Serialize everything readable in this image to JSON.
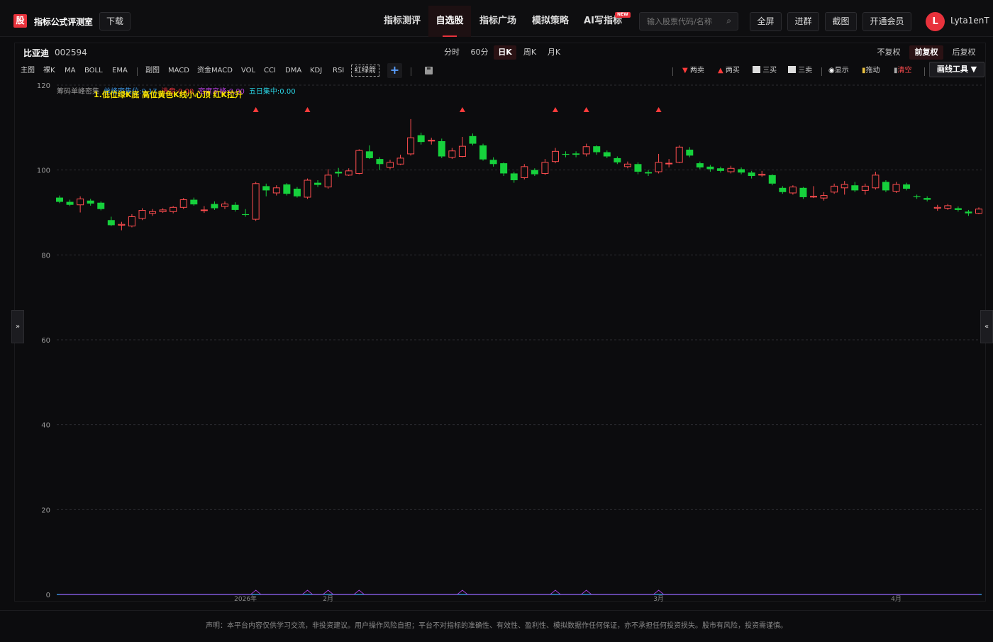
{
  "header": {
    "logo_char": "股",
    "brand": "指标公式评测室",
    "download": "下载",
    "nav": [
      {
        "label": "指标测评",
        "active": false
      },
      {
        "label": "自选股",
        "active": true
      },
      {
        "label": "指标广场",
        "active": false
      },
      {
        "label": "模拟策略",
        "active": false
      },
      {
        "label": "AI写指标",
        "active": false
      }
    ],
    "new_badge": "NEW",
    "search_placeholder": "输入股票代码/名称",
    "search_icon": "search-icon",
    "buttons": [
      "全屏",
      "进群",
      "截图",
      "开通会员"
    ],
    "avatar_letter": "L",
    "username": "Lyta1enT"
  },
  "stock": {
    "name": "比亚迪",
    "code": "002594"
  },
  "periods": [
    {
      "label": "分时",
      "active": false
    },
    {
      "label": "60分",
      "active": false
    },
    {
      "label": "日K",
      "active": true
    },
    {
      "label": "周K",
      "active": false
    },
    {
      "label": "月K",
      "active": false
    }
  ],
  "adjust": [
    {
      "label": "不复权",
      "active": false
    },
    {
      "label": "前复权",
      "active": true
    },
    {
      "label": "后复权",
      "active": false
    }
  ],
  "indicators_main": [
    "主图",
    "裸K",
    "MA",
    "BOLL",
    "EMA"
  ],
  "indicators_sub": [
    "副图",
    "MACD",
    "资金MACD",
    "VOL",
    "CCI",
    "DMA",
    "KDJ",
    "RSI"
  ],
  "highlighted_indicator": "红绿箭",
  "add_label": "+",
  "tools": {
    "sell2": "两卖",
    "buy2": "两买",
    "buy3": "三买",
    "sell3": "三卖",
    "show": "显示",
    "drag": "拖动",
    "clear": "清空",
    "draw_tool": "画线工具 ▼"
  },
  "legend": [
    {
      "text": "筹码单峰密集",
      "color": "#9a9a9a"
    },
    {
      "text": "单峰密集位:0.17",
      "color": "#3a8fd8"
    },
    {
      "text": "洗盘:0.00",
      "color": "#e8323c"
    },
    {
      "text": "密度高峰:0.00",
      "color": "#b23cd8"
    },
    {
      "text": "五日集中:0.00",
      "color": "#2ad8e8"
    }
  ],
  "overlay_text": "1.低位绿K底 高位黄色K线小心顶 红K拉升",
  "x_axis_labels": [
    "2026年",
    "2月",
    "3月",
    "4月"
  ],
  "chart_data": {
    "type": "candlestick",
    "ylim": [
      0,
      120
    ],
    "yticks": [
      0,
      20,
      40,
      60,
      80,
      100,
      120
    ],
    "colors": {
      "up": "#ff4d4f",
      "down": "#16d13c",
      "marker": "#ff3b3b",
      "signal": "#a03cd8",
      "baseline": "#3a8fd8"
    },
    "candles": [
      [
        93.5,
        92.5,
        94.0,
        92.2
      ],
      [
        92.5,
        91.8,
        93.0,
        91.5
      ],
      [
        91.8,
        93.2,
        93.8,
        90.0
      ],
      [
        92.8,
        92.1,
        93.2,
        91.6
      ],
      [
        92.3,
        90.8,
        92.6,
        90.5
      ],
      [
        88.2,
        87.0,
        89.0,
        86.8
      ],
      [
        87.0,
        87.2,
        87.8,
        85.8
      ],
      [
        86.8,
        89.0,
        89.6,
        86.5
      ],
      [
        88.6,
        90.5,
        91.0,
        88.2
      ],
      [
        89.8,
        90.2,
        90.8,
        89.2
      ],
      [
        90.2,
        90.6,
        91.0,
        89.9
      ],
      [
        90.2,
        91.2,
        91.5,
        89.8
      ],
      [
        91.2,
        93.0,
        93.4,
        90.8
      ],
      [
        93.0,
        91.9,
        93.5,
        91.6
      ],
      [
        90.5,
        90.6,
        91.5,
        89.9
      ],
      [
        92.0,
        91.0,
        92.6,
        90.6
      ],
      [
        91.4,
        92.0,
        92.6,
        90.8
      ],
      [
        91.8,
        90.6,
        92.4,
        90.2
      ],
      [
        89.6,
        89.4,
        90.8,
        89.0
      ],
      [
        88.4,
        96.8,
        97.2,
        88.0
      ],
      [
        96.2,
        95.2,
        96.8,
        93.8
      ],
      [
        94.6,
        95.8,
        96.4,
        94.0
      ],
      [
        96.6,
        94.4,
        96.9,
        94.0
      ],
      [
        95.6,
        93.8,
        96.0,
        93.5
      ],
      [
        93.6,
        97.6,
        98.0,
        93.2
      ],
      [
        97.0,
        96.5,
        97.6,
        96.0
      ],
      [
        96.0,
        98.8,
        100.2,
        95.6
      ],
      [
        99.6,
        99.2,
        100.5,
        98.4
      ],
      [
        98.8,
        99.8,
        100.4,
        98.6
      ],
      [
        99.2,
        104.6,
        104.9,
        99.0
      ],
      [
        104.4,
        102.8,
        105.8,
        102.6
      ],
      [
        102.6,
        101.4,
        103.0,
        100.0
      ],
      [
        100.6,
        101.8,
        102.4,
        100.2
      ],
      [
        101.4,
        102.8,
        103.6,
        101.2
      ],
      [
        103.8,
        107.6,
        112.0,
        103.4
      ],
      [
        108.2,
        106.6,
        108.8,
        106.0
      ],
      [
        107.0,
        107.0,
        107.6,
        106.0
      ],
      [
        106.8,
        103.2,
        107.4,
        102.8
      ],
      [
        103.0,
        104.5,
        105.2,
        102.6
      ],
      [
        103.2,
        105.6,
        107.8,
        103.0
      ],
      [
        108.0,
        106.2,
        108.6,
        105.8
      ],
      [
        105.8,
        102.5,
        106.2,
        102.2
      ],
      [
        102.4,
        101.4,
        103.0,
        100.8
      ],
      [
        101.6,
        99.2,
        101.8,
        98.6
      ],
      [
        99.2,
        97.6,
        99.6,
        97.0
      ],
      [
        98.2,
        100.8,
        101.4,
        97.8
      ],
      [
        100.0,
        99.0,
        100.4,
        98.6
      ],
      [
        99.2,
        101.8,
        102.6,
        98.8
      ],
      [
        102.0,
        104.4,
        105.2,
        101.6
      ],
      [
        103.8,
        103.6,
        104.4,
        103.0
      ],
      [
        103.9,
        103.6,
        104.4,
        103.0
      ],
      [
        103.8,
        105.5,
        106.2,
        103.2
      ],
      [
        105.6,
        104.2,
        105.8,
        103.6
      ],
      [
        104.2,
        103.2,
        104.6,
        102.8
      ],
      [
        102.8,
        101.8,
        103.2,
        101.4
      ],
      [
        100.8,
        101.4,
        102.0,
        100.4
      ],
      [
        101.4,
        99.6,
        101.8,
        99.0
      ],
      [
        99.5,
        99.2,
        100.0,
        98.6
      ],
      [
        99.6,
        101.8,
        103.8,
        99.2
      ],
      [
        101.6,
        101.6,
        102.6,
        100.6
      ],
      [
        101.8,
        105.4,
        105.8,
        101.6
      ],
      [
        104.8,
        103.4,
        105.4,
        103.0
      ],
      [
        101.6,
        100.6,
        102.0,
        100.2
      ],
      [
        100.8,
        100.2,
        101.2,
        99.6
      ],
      [
        100.4,
        99.8,
        100.8,
        99.4
      ],
      [
        99.6,
        100.4,
        101.0,
        99.2
      ],
      [
        100.2,
        99.4,
        100.6,
        99.0
      ],
      [
        99.4,
        98.6,
        99.8,
        98.0
      ],
      [
        98.8,
        99.0,
        99.8,
        98.4
      ],
      [
        98.8,
        96.8,
        99.0,
        96.4
      ],
      [
        95.8,
        94.8,
        96.2,
        94.4
      ],
      [
        94.6,
        96.0,
        96.4,
        94.2
      ],
      [
        95.8,
        93.6,
        96.0,
        93.2
      ],
      [
        93.8,
        93.8,
        96.2,
        93.4
      ],
      [
        93.4,
        94.0,
        94.8,
        92.8
      ],
      [
        94.8,
        96.2,
        96.8,
        94.4
      ],
      [
        95.8,
        96.6,
        97.4,
        94.2
      ],
      [
        96.4,
        95.2,
        97.2,
        94.8
      ],
      [
        95.2,
        96.2,
        96.8,
        94.2
      ],
      [
        95.8,
        98.8,
        99.6,
        95.4
      ],
      [
        97.2,
        95.2,
        97.6,
        94.8
      ],
      [
        95.0,
        96.6,
        97.2,
        94.6
      ],
      [
        96.6,
        95.6,
        97.0,
        95.2
      ],
      [
        93.8,
        93.6,
        94.2,
        93.2
      ],
      [
        93.4,
        93.0,
        93.8,
        92.6
      ],
      [
        91.0,
        91.2,
        91.8,
        90.4
      ],
      [
        91.0,
        91.6,
        92.0,
        90.6
      ],
      [
        91.0,
        90.6,
        91.4,
        90.2
      ],
      [
        90.2,
        89.8,
        90.6,
        89.2
      ],
      [
        89.8,
        90.8,
        91.2,
        89.6
      ]
    ],
    "markers": [
      19,
      24,
      39,
      48,
      51,
      58
    ],
    "signals": [
      19,
      24,
      26,
      29,
      39,
      48,
      51,
      58
    ]
  },
  "disclaimer": "声明：本平台内容仅供学习交流，非投资建议。用户操作风险自担；平台不对指标的准确性、有效性、盈利性、模拟数据作任何保证，亦不承担任何投资损失。股市有风险，投资需谨慎。"
}
